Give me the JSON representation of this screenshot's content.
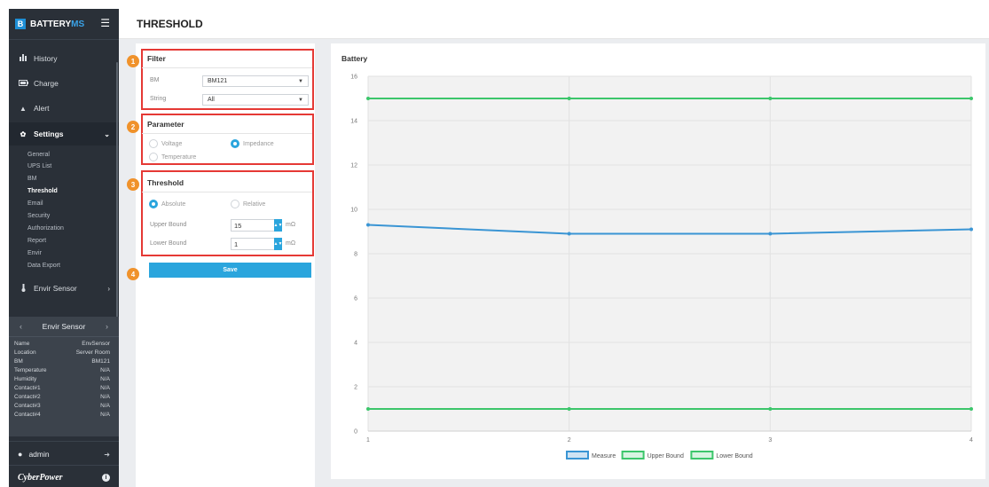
{
  "app": {
    "brand_letter": "B",
    "brand_name": "BATTERY",
    "brand_suffix": "MS",
    "page_title": "THRESHOLD",
    "accent": "#2aa5dd"
  },
  "sidebar": {
    "items": [
      {
        "label": "History",
        "icon": "bar-chart-icon"
      },
      {
        "label": "Charge",
        "icon": "battery-icon"
      },
      {
        "label": "Alert",
        "icon": "warning-icon"
      },
      {
        "label": "Settings",
        "icon": "gear-icon"
      },
      {
        "label": "Envir Sensor",
        "icon": "thermometer-icon"
      }
    ],
    "settings_sub": [
      "General",
      "UPS List",
      "BM",
      "Threshold",
      "Email",
      "Security",
      "Authorization",
      "Report",
      "Envir",
      "Data Export"
    ],
    "selected_sub": "Threshold"
  },
  "envir_card": {
    "title": "Envir Sensor",
    "rows": [
      {
        "k": "Name",
        "v": "EnvSensor"
      },
      {
        "k": "Location",
        "v": "Server Room"
      },
      {
        "k": "BM",
        "v": "BM121"
      },
      {
        "k": "Temperature",
        "v": "N/A"
      },
      {
        "k": "Humidity",
        "v": "N/A"
      },
      {
        "k": "Contact#1",
        "v": "N/A"
      },
      {
        "k": "Contact#2",
        "v": "N/A"
      },
      {
        "k": "Contact#3",
        "v": "N/A"
      },
      {
        "k": "Contact#4",
        "v": "N/A"
      }
    ]
  },
  "user": {
    "name": "admin"
  },
  "footer": {
    "logo": "CyberPower"
  },
  "filter": {
    "title": "Filter",
    "bm_label": "BM",
    "bm_value": "BM121",
    "string_label": "String",
    "string_value": "All"
  },
  "parameter": {
    "title": "Parameter",
    "options": [
      {
        "label": "Voltage",
        "checked": false
      },
      {
        "label": "Impedance",
        "checked": true
      },
      {
        "label": "Temperature",
        "checked": false
      }
    ]
  },
  "threshold": {
    "title": "Threshold",
    "absolute_label": "Absolute",
    "absolute_checked": true,
    "relative_label": "Relative",
    "relative_checked": false,
    "upper_label": "Upper Bound",
    "upper_value": "15",
    "lower_label": "Lower Bound",
    "lower_value": "1",
    "unit": "mΩ"
  },
  "save_label": "Save",
  "badges": [
    "1",
    "2",
    "3",
    "4"
  ],
  "chart_data": {
    "type": "line",
    "title": "Battery",
    "x": [
      1,
      2,
      3,
      4
    ],
    "ylim": [
      0,
      16
    ],
    "yticks": [
      0,
      2,
      4,
      6,
      8,
      10,
      12,
      14,
      16
    ],
    "grid": true,
    "legend_position": "bottom",
    "series": [
      {
        "name": "Measure",
        "values": [
          9.3,
          8.9,
          8.9,
          9.1
        ],
        "color": "#3a95d4"
      },
      {
        "name": "Upper Bound",
        "values": [
          15,
          15,
          15,
          15
        ],
        "color": "#3cc66b"
      },
      {
        "name": "Lower Bound",
        "values": [
          1,
          1,
          1,
          1
        ],
        "color": "#3cc66b"
      }
    ]
  }
}
